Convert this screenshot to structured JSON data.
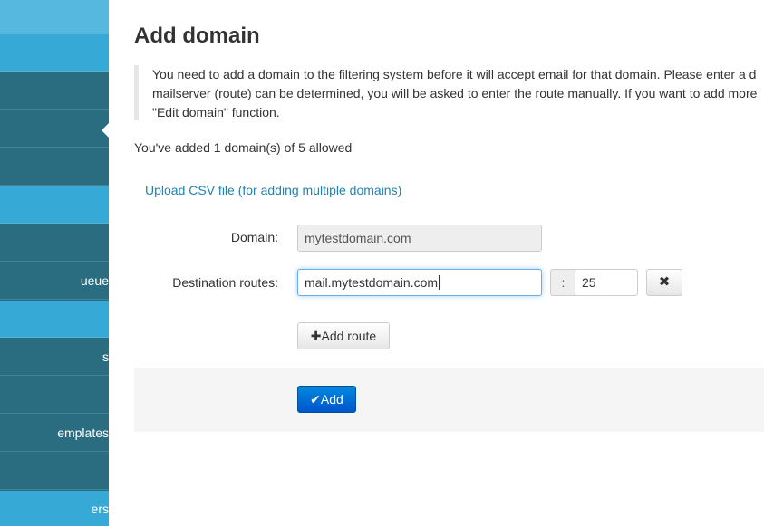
{
  "sidebar": {
    "items": [
      {
        "label": "",
        "tone": "light"
      },
      {
        "label": "",
        "tone": "dark"
      },
      {
        "label": "",
        "tone": "dark"
      },
      {
        "label": "",
        "tone": "dark"
      },
      {
        "label": "",
        "tone": "light"
      },
      {
        "label": "",
        "tone": "dark"
      },
      {
        "label": "ueue",
        "tone": "dark"
      },
      {
        "label": "",
        "tone": "light"
      },
      {
        "label": "s",
        "tone": "dark"
      },
      {
        "label": "",
        "tone": "dark"
      },
      {
        "label": "emplates",
        "tone": "dark"
      },
      {
        "label": "",
        "tone": "dark"
      },
      {
        "label": "ers",
        "tone": "light"
      }
    ]
  },
  "page": {
    "title": "Add domain",
    "notice_lines": [
      "You need to add a domain to the filtering system before it will accept email for that domain. Please enter a d",
      "mailserver (route) can be determined, you will be asked to enter the route manually. If you want to add more",
      "\"Edit domain\" function."
    ],
    "domain_count": "You've added 1 domain(s) of 5 allowed",
    "upload_link": "Upload CSV file (for adding multiple domains)"
  },
  "form": {
    "domain_label": "Domain:",
    "domain_value": "mytestdomain.com",
    "routes_label": "Destination routes:",
    "route_host": "mail.mytestdomain.com",
    "port_separator": ":",
    "route_port": "25",
    "remove_icon": "✖",
    "add_route_icon": "✚",
    "add_route_label": "Add route",
    "submit_icon": "✔",
    "submit_label": "Add"
  },
  "colors": {
    "sidebar_dark": "#2a6d80",
    "sidebar_light": "#36a9d6",
    "link": "#2083b1",
    "primary_button": "#0066cc"
  }
}
